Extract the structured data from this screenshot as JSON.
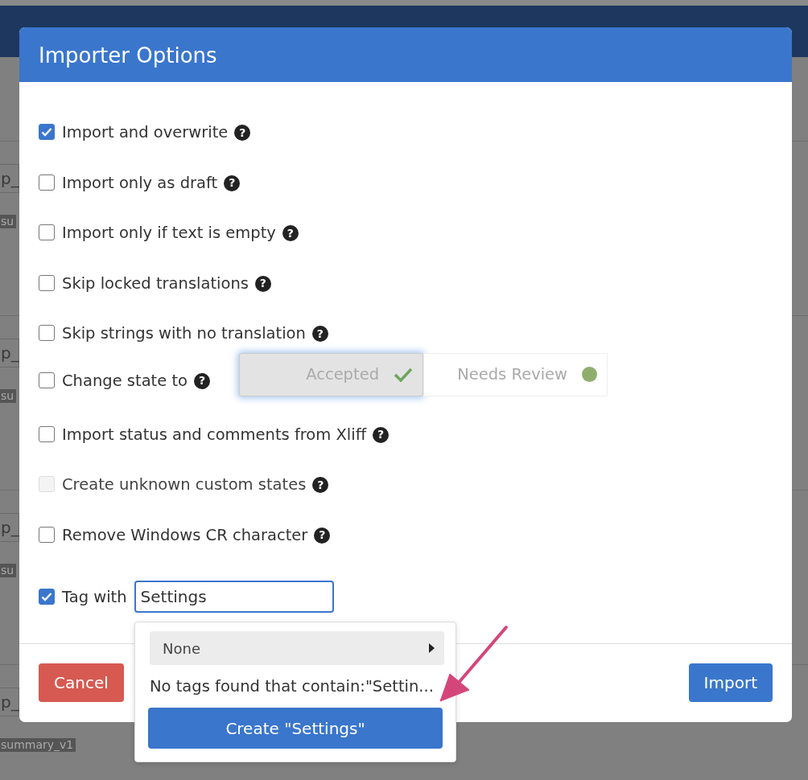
{
  "background": {
    "rows": [
      {
        "field": "p_",
        "label": "su"
      },
      {
        "field": "p_",
        "label": "su"
      },
      {
        "field": "p_",
        "label": "su"
      },
      {
        "field": "p_",
        "label": "summary_v1"
      }
    ]
  },
  "modal": {
    "title": "Importer Options",
    "options": [
      {
        "kind": "plain",
        "label": "Import and overwrite",
        "help": "?",
        "checked": true,
        "disabled": false
      },
      {
        "kind": "plain",
        "label": "Import only as draft",
        "help": "?",
        "checked": false,
        "disabled": false
      },
      {
        "kind": "plain",
        "label": "Import only if text is empty",
        "help": "?",
        "checked": false,
        "disabled": false
      },
      {
        "kind": "plain",
        "label": "Skip locked translations",
        "help": "?",
        "checked": false,
        "disabled": false
      },
      {
        "kind": "plain",
        "label": "Skip strings with no translation",
        "help": "?",
        "checked": false,
        "disabled": false
      },
      {
        "kind": "state",
        "label": "Change state to",
        "help": "?",
        "checked": false,
        "disabled": false,
        "states": [
          {
            "label": "Accepted",
            "selected": true,
            "kind": "check",
            "color": "#6ea55e"
          },
          {
            "label": "Needs Review",
            "selected": false,
            "kind": "dot",
            "color": "#8fae6e"
          }
        ]
      },
      {
        "kind": "plain",
        "label": "Import status and comments from Xliff",
        "help": "?",
        "checked": false,
        "disabled": false
      },
      {
        "kind": "plain",
        "label": "Create unknown custom states",
        "help": "?",
        "checked": false,
        "disabled": true
      },
      {
        "kind": "plain",
        "label": "Remove Windows CR character",
        "help": "?",
        "checked": false,
        "disabled": false
      },
      {
        "kind": "tag",
        "label": "Tag with",
        "checked": true,
        "disabled": false,
        "value": "Settings"
      }
    ],
    "buttons": [
      {
        "kind": "cancel",
        "label": "Cancel"
      },
      {
        "kind": "primary",
        "label": "Import"
      }
    ],
    "dropdown": {
      "item": "None",
      "message": "No tags found that contain:\"Settin...",
      "create_button": "Create \"Settings\""
    }
  }
}
